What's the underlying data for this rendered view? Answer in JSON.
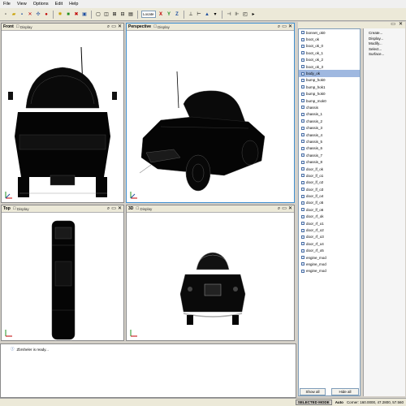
{
  "menu": {
    "items": [
      "File",
      "View",
      "Options",
      "Edit",
      "Help"
    ]
  },
  "toolbar": {
    "select_value": "Locate"
  },
  "viewports": {
    "front": {
      "title": "Front",
      "display": "Display"
    },
    "perspective": {
      "title": "Perspective",
      "display": "Display"
    },
    "top": {
      "title": "Top",
      "display": "Display"
    },
    "view3d": {
      "title": "3D",
      "display": "Display"
    }
  },
  "objects": [
    "bonnet_ok0",
    "boot_ok",
    "boot_ok_0",
    "boot_ok_1",
    "boot_ok_2",
    "boot_ok_3",
    "body_ok",
    "bump_hok0",
    "bump_hok1",
    "bump_hok0",
    "bump_mok0",
    "chassis",
    "chassis_1",
    "chassis_2",
    "chassis_3",
    "chassis_4",
    "chassis_5",
    "chassis_6",
    "chassis_7",
    "chassis_8",
    "door_lf_ok",
    "door_lf_o1",
    "door_lf_o2",
    "door_lf_o3",
    "door_lf_o4",
    "door_lf_o5",
    "door_lf_o6",
    "door_rf_ok",
    "door_rf_o1",
    "door_rf_o2",
    "door_rf_o3",
    "door_rf_o4",
    "door_rf_o5",
    "engine_mod",
    "engine_mod",
    "engine_mod"
  ],
  "selected_index": 6,
  "buttons": {
    "show_all": "Show all",
    "hide_all": "Hide all"
  },
  "commands": [
    "Create...",
    "Display...",
    "Modify...",
    "Select...",
    "Surface..."
  ],
  "console": {
    "message": "Zbrsheler is ready..."
  },
  "status": {
    "mode": "SELECTED MODE",
    "label": "Auto",
    "coords": "Corner: 160.0000, 47.2800, 57.560"
  }
}
